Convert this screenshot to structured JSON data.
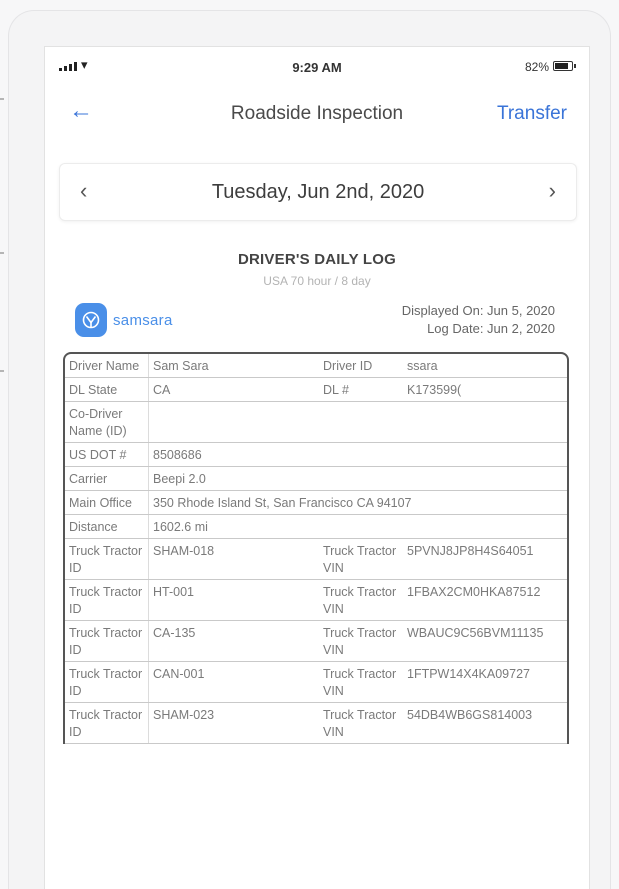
{
  "status_bar": {
    "time": "9:29 AM",
    "battery": "82%",
    "battery_level": 0.82
  },
  "nav": {
    "title": "Roadside Inspection",
    "action": "Transfer",
    "back_icon": "arrow-left-icon"
  },
  "date_bar": {
    "date": "Tuesday, Jun 2nd, 2020",
    "prev_icon": "chevron-left-icon",
    "next_icon": "chevron-right-icon"
  },
  "log": {
    "title": "DRIVER'S DAILY LOG",
    "subtitle": "USA 70 hour / 8 day",
    "brand": "samsara",
    "displayed_on": "Displayed On: Jun 5, 2020",
    "log_date": "Log Date: Jun 2, 2020"
  },
  "info": {
    "driver_name_label": "Driver Name",
    "driver_name": "Sam Sara",
    "driver_id_label": "Driver ID",
    "driver_id": "ssara",
    "dl_state_label": "DL State",
    "dl_state": "CA",
    "dl_number_label": "DL #",
    "dl_number": "K173599(",
    "co_driver_label": "Co-Driver Name (ID)",
    "us_dot_label": "US DOT #",
    "us_dot": "8508686",
    "carrier_label": "Carrier",
    "carrier": "Beepi 2.0",
    "main_office_label": "Main Office",
    "main_office": "350 Rhode Island St, San Francisco CA 94107",
    "distance_label": "Distance",
    "distance": "1602.6 mi"
  },
  "vehicles": [
    {
      "id_label": "Truck Tractor ID",
      "id": "SHAM-018",
      "vin_label": "Truck Tractor VIN",
      "vin": "5PVNJ8JP8H4S64051"
    },
    {
      "id_label": "Truck Tractor ID",
      "id": "HT-001",
      "vin_label": "Truck Tractor VIN",
      "vin": "1FBAX2CM0HKA87512"
    },
    {
      "id_label": "Truck Tractor ID",
      "id": "CA-135",
      "vin_label": "Truck Tractor VIN",
      "vin": "WBAUC9C56BVM11135"
    },
    {
      "id_label": "Truck Tractor ID",
      "id": "CAN-001",
      "vin_label": "Truck Tractor VIN",
      "vin": "1FTPW14X4KA09727"
    },
    {
      "id_label": "Truck Tractor ID",
      "id": "SHAM-023",
      "vin_label": "Truck Tractor VIN",
      "vin": "54DB4WB6GS814003"
    }
  ],
  "colors": {
    "accent": "#3a74d8",
    "brand": "#4a8fe8"
  }
}
